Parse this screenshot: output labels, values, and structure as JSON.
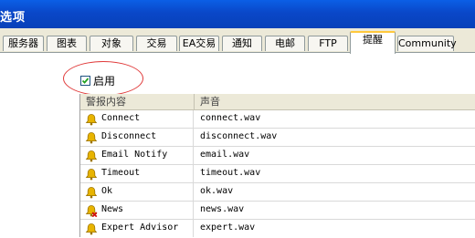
{
  "window": {
    "title": "选项"
  },
  "tabs": [
    {
      "label": "服务器",
      "active": false
    },
    {
      "label": "图表",
      "active": false
    },
    {
      "label": "对象",
      "active": false
    },
    {
      "label": "交易",
      "active": false
    },
    {
      "label": "EA交易",
      "active": false
    },
    {
      "label": "通知",
      "active": false
    },
    {
      "label": "电邮",
      "active": false
    },
    {
      "label": "FTP",
      "active": false
    },
    {
      "label": "提醒",
      "active": true
    },
    {
      "label": "Community",
      "active": false
    }
  ],
  "events": {
    "enable_label": "启用",
    "enabled": true,
    "columns": {
      "event": "警报内容",
      "sound": "声音"
    },
    "rows": [
      {
        "name": "Connect",
        "sound": "connect.wav",
        "icon": "bell-icon"
      },
      {
        "name": "Disconnect",
        "sound": "disconnect.wav",
        "icon": "bell-icon"
      },
      {
        "name": "Email Notify",
        "sound": "email.wav",
        "icon": "bell-icon"
      },
      {
        "name": "Timeout",
        "sound": "timeout.wav",
        "icon": "bell-icon"
      },
      {
        "name": "Ok",
        "sound": "ok.wav",
        "icon": "bell-icon"
      },
      {
        "name": "News",
        "sound": "news.wav",
        "icon": "bell-disabled-icon"
      },
      {
        "name": "Expert Advisor",
        "sound": "expert.wav",
        "icon": "bell-icon"
      }
    ]
  },
  "colors": {
    "titlebar": "#0a47c8",
    "highlight_circle": "#e03a3a",
    "bell": "#e8b400",
    "disabled_cross": "#d01010"
  }
}
